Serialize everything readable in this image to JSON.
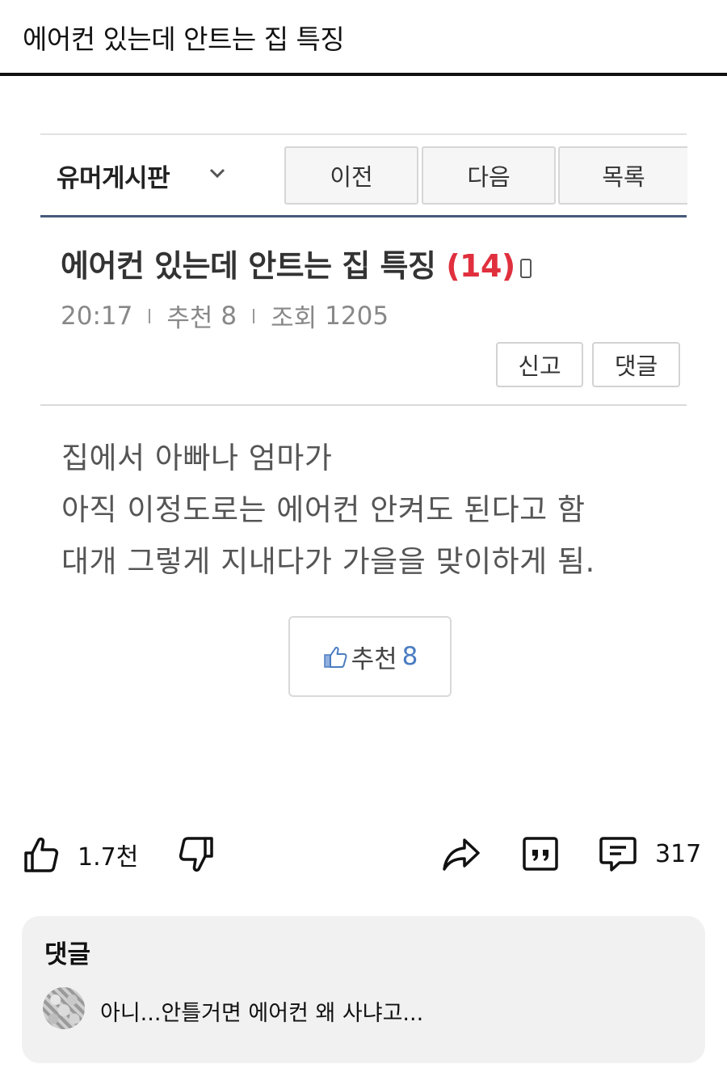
{
  "header": {
    "title": "에어컨 있는데 안트는 집 특징"
  },
  "board": {
    "name": "유머게시판",
    "nav": {
      "prev": "이전",
      "next": "다음",
      "list": "목록"
    }
  },
  "post": {
    "title": "에어컨 있는데 안트는 집 특징",
    "comment_count": "(14)",
    "time": "20:17",
    "recommend_label": "추천",
    "recommend_value": "8",
    "views_label": "조회",
    "views_value": "1205",
    "report_label": "신고",
    "comment_label": "댓글",
    "body": [
      "집에서 아빠나 엄마가",
      "아직 이정도로는 에어컨 안켜도 된다고 함",
      "대개 그렇게 지내다가 가을을 맞이하게 됨."
    ],
    "recommend_button": {
      "label": "추천",
      "count": "8"
    }
  },
  "actions": {
    "likes": "1.7천",
    "comments": "317"
  },
  "comments_panel": {
    "heading": "댓글",
    "top_comment": "아니...안틀거면 에어컨 왜 사냐고..."
  },
  "colors": {
    "accent_red": "#e0303e",
    "accent_blue": "#4a7cc1",
    "board_underline": "#46597a"
  }
}
